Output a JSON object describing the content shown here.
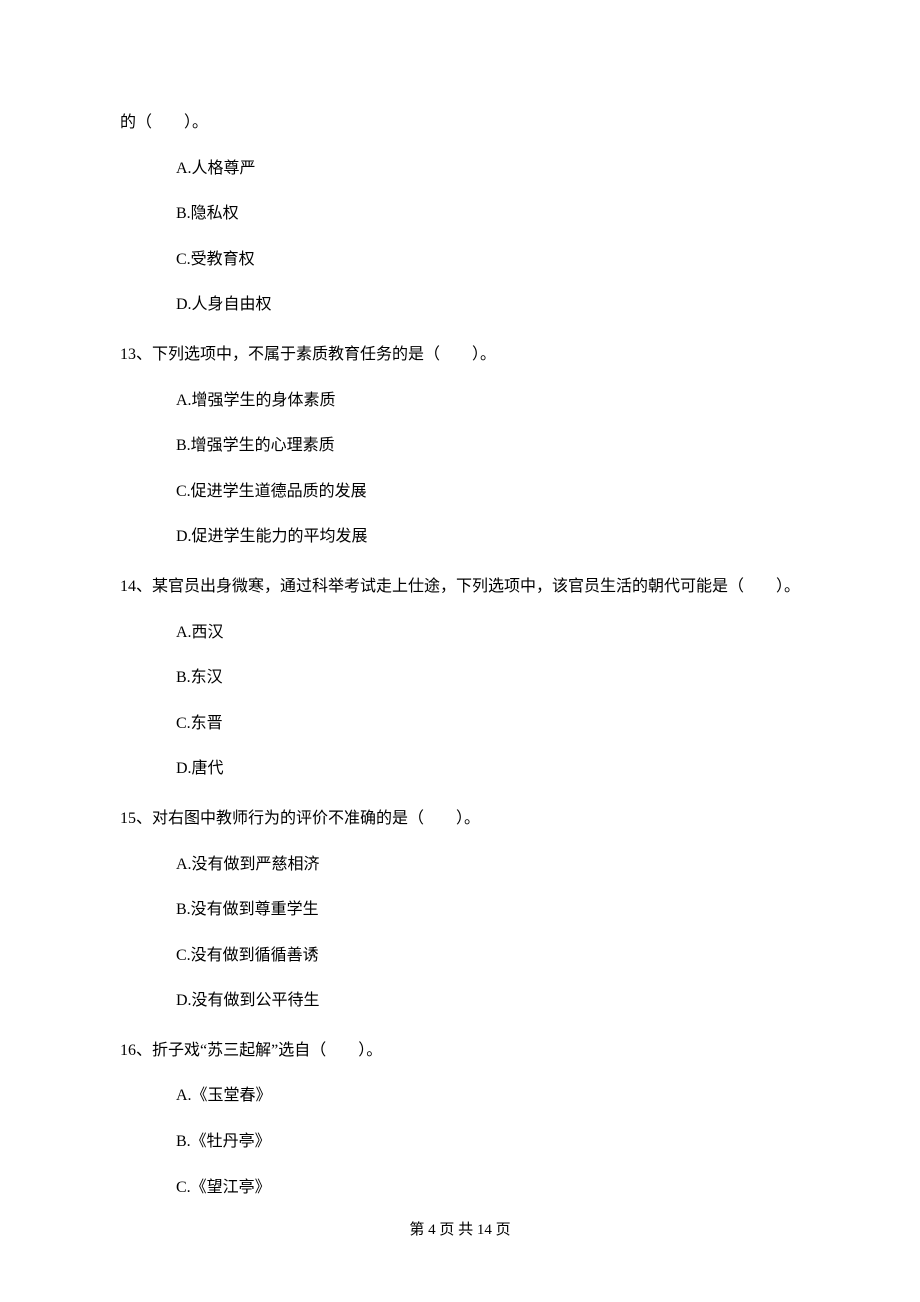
{
  "q12": {
    "tail": "的（　　）。",
    "A": "A.人格尊严",
    "B": "B.隐私权",
    "C": "C.受教育权",
    "D": "D.人身自由权"
  },
  "q13": {
    "stem": "13、下列选项中，不属于素质教育任务的是（　　）。",
    "A": "A.增强学生的身体素质",
    "B": "B.增强学生的心理素质",
    "C": "C.促进学生道德品质的发展",
    "D": "D.促进学生能力的平均发展"
  },
  "q14": {
    "stem": "14、某官员出身微寒，通过科举考试走上仕途，下列选项中，该官员生活的朝代可能是（　　）。",
    "A": "A.西汉",
    "B": "B.东汉",
    "C": "C.东晋",
    "D": "D.唐代"
  },
  "q15": {
    "stem": "15、对右图中教师行为的评价不准确的是（　　）。",
    "A": "A.没有做到严慈相济",
    "B": "B.没有做到尊重学生",
    "C": "C.没有做到循循善诱",
    "D": "D.没有做到公平待生"
  },
  "q16": {
    "stem": "16、折子戏“苏三起解”选自（　　）。",
    "A": "A.《玉堂春》",
    "B": "B.《牡丹亭》",
    "C": "C.《望江亭》"
  },
  "footer": "第 4 页 共 14 页"
}
